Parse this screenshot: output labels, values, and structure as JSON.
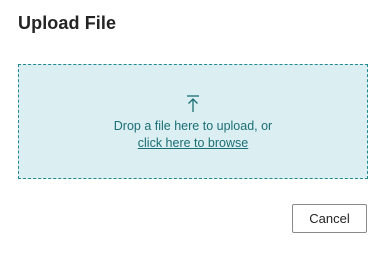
{
  "dialog": {
    "title": "Upload File"
  },
  "dropzone": {
    "icon": "upload-arrow-icon",
    "instruction": "Drop a file here to upload, or",
    "browse_link": "click here to browse",
    "accent_color": "#1a6f75",
    "background_color": "#dbeef1"
  },
  "actions": {
    "cancel_label": "Cancel"
  }
}
